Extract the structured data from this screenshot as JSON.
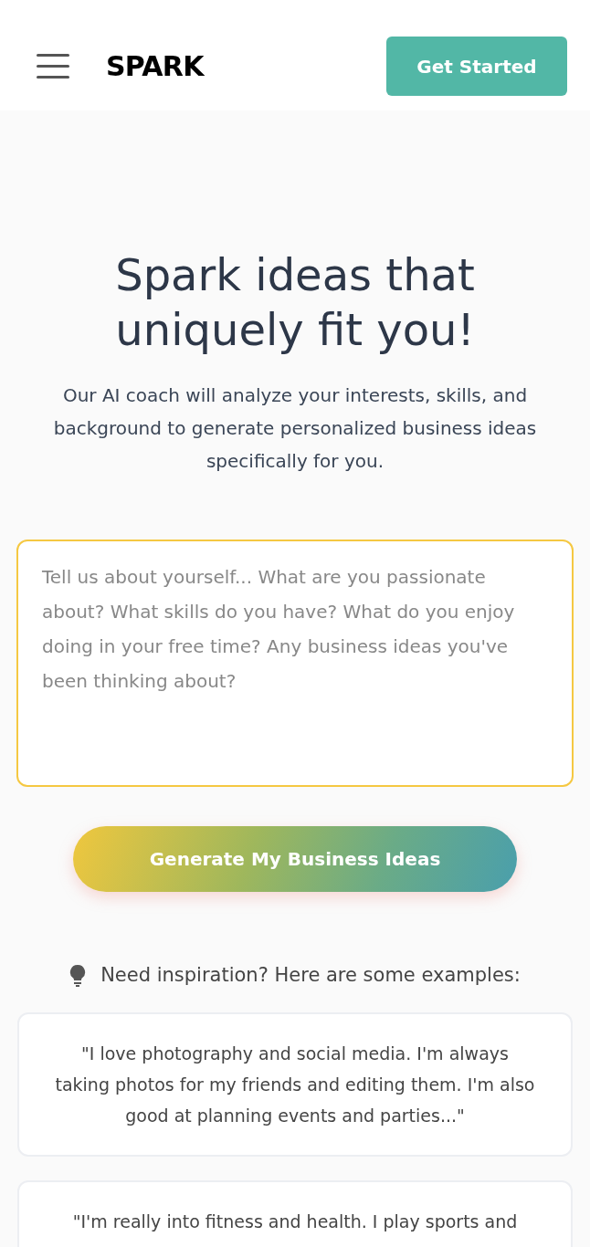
{
  "header": {
    "logo": "SPARK",
    "cta": "Get Started"
  },
  "hero": {
    "title": "Spark ideas that uniquely fit you!",
    "subtitle": "Our AI coach will analyze your interests, skills, and background to generate personalized business ideas specifically for you."
  },
  "prompt": {
    "placeholder": "Tell us about yourself... What are you passionate about? What skills do you have? What do you enjoy doing in your free time? Any business ideas you've been thinking about?",
    "focused": true
  },
  "generate_button": "Generate My Business Ideas",
  "examples": {
    "heading": "Need inspiration? Here are some examples:",
    "items": [
      {
        "text": "\"I love photography and social media. I'm always taking photos for my friends and editing them. I'm also good at planning events and parties...\""
      },
      {
        "text": "\"I'm really into fitness and health. I play sports and"
      }
    ]
  }
}
